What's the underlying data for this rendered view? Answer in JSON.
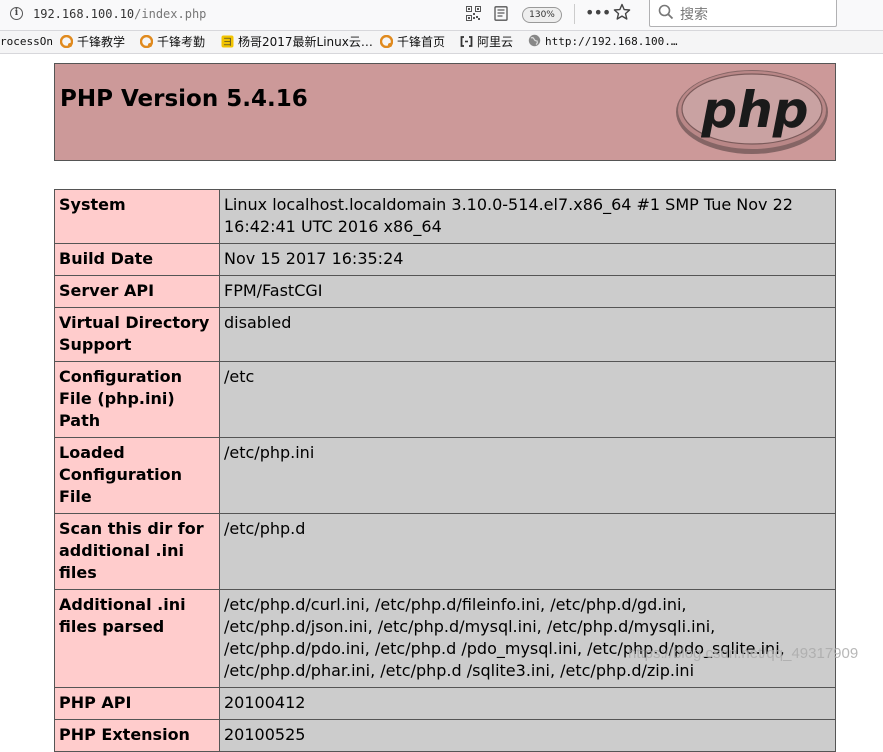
{
  "browser": {
    "url_host": "192.168.100.10",
    "url_path": "/index.php",
    "zoom": "130%",
    "more": "•••",
    "search_placeholder": "搜索"
  },
  "bookmarks": [
    {
      "label": "rocessOn",
      "icon": "none"
    },
    {
      "label": "千锋教学",
      "icon": "qianfeng-logo-icon"
    },
    {
      "label": "千锋考勤",
      "icon": "qianfeng-logo-icon"
    },
    {
      "label": "杨哥2017最新Linux云…",
      "icon": "bookmark-page-icon"
    },
    {
      "label": "千锋首页",
      "icon": "qianfeng-logo-icon"
    },
    {
      "label": "阿里云",
      "icon": "aliyun-logo-icon"
    },
    {
      "label": "http://192.168.100.…",
      "icon": "globe-icon"
    }
  ],
  "php": {
    "title": "PHP Version 5.4.16",
    "logo_text": "php",
    "rows": [
      {
        "key": "System",
        "value": "Linux localhost.localdomain 3.10.0-514.el7.x86_64 #1 SMP Tue Nov 22 16:42:41 UTC 2016 x86_64"
      },
      {
        "key": "Build Date",
        "value": "Nov 15 2017 16:35:24"
      },
      {
        "key": "Server API",
        "value": "FPM/FastCGI"
      },
      {
        "key": "Virtual Directory Support",
        "value": "disabled"
      },
      {
        "key": "Configuration File (php.ini) Path",
        "value": "/etc"
      },
      {
        "key": "Loaded Configuration File",
        "value": "/etc/php.ini"
      },
      {
        "key": "Scan this dir for additional .ini files",
        "value": "/etc/php.d"
      },
      {
        "key": "Additional .ini files parsed",
        "value": "/etc/php.d/curl.ini, /etc/php.d/fileinfo.ini, /etc/php.d/gd.ini, /etc/php.d/json.ini, /etc/php.d/mysql.ini, /etc/php.d/mysqli.ini, /etc/php.d/pdo.ini, /etc/php.d /pdo_mysql.ini, /etc/php.d/pdo_sqlite.ini, /etc/php.d/phar.ini, /etc/php.d /sqlite3.ini, /etc/php.d/zip.ini"
      },
      {
        "key": "PHP API",
        "value": "20100412"
      },
      {
        "key": "PHP Extension",
        "value": "20100525"
      }
    ]
  },
  "watermark": "https://blog.csdn.net/qq_49317909",
  "colors": {
    "header_bg": "#cc9999",
    "key_bg": "#ffcccc",
    "value_bg": "#cccccc",
    "logo_oval": "#6c7eb7"
  }
}
